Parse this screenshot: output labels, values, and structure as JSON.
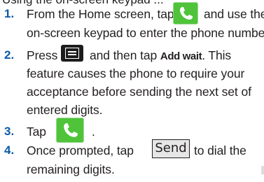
{
  "header_fragment": "Using the on-screen keypad ...",
  "steps": [
    {
      "number": "1.",
      "line1_pre": "From the Home screen, tap",
      "line1_post": "and use the",
      "line2": "on-screen keypad to enter the phone number."
    },
    {
      "number": "2.",
      "line1_pre": "Press",
      "line1_mid": "and then tap",
      "line1_bold": "Add wait",
      "line1_post": ". This",
      "line2": "feature causes the phone to require your",
      "line3": "acceptance before sending the next set of",
      "line4": "entered digits."
    },
    {
      "number": "3.",
      "line1_pre": "Tap",
      "line1_post": "."
    },
    {
      "number": "4.",
      "line1_pre": "Once prompted, tap",
      "button_label": "Send",
      "line1_post": "to dial the",
      "line2": "remaining digits."
    }
  ],
  "icons": {
    "phone": "phone-icon",
    "menu": "menu-icon"
  },
  "colors": {
    "step_number": "#0b5aa6",
    "phone_icon_bg": "#4fc43a",
    "menu_icon_bg": "#1c1c1c",
    "text": "#231f20"
  }
}
